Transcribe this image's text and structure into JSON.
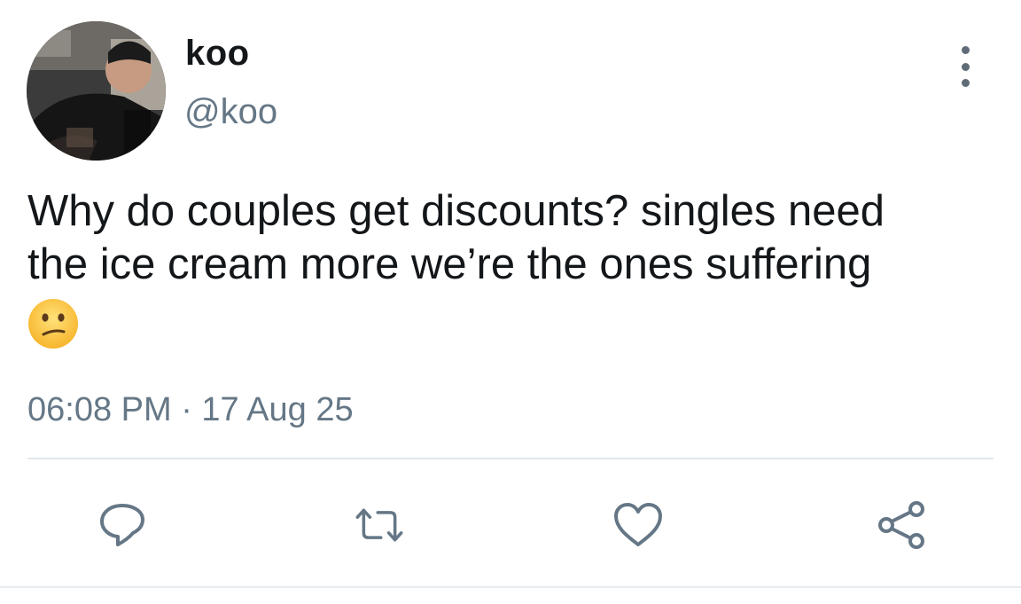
{
  "user": {
    "display_name": "koo",
    "handle": "@koo"
  },
  "tweet": {
    "text": "Why do couples get discounts? singles need\nthe ice cream more we’re the ones suffering",
    "emoji": "confused-face-icon",
    "timestamp": "06:08 PM · 17 Aug 25"
  },
  "actions": [
    "reply-icon",
    "retweet-icon",
    "like-icon",
    "share-icon"
  ],
  "colors": {
    "text_primary": "#14171a",
    "text_secondary": "#657786",
    "icon": "#657786",
    "divider": "#e1e8ed"
  }
}
